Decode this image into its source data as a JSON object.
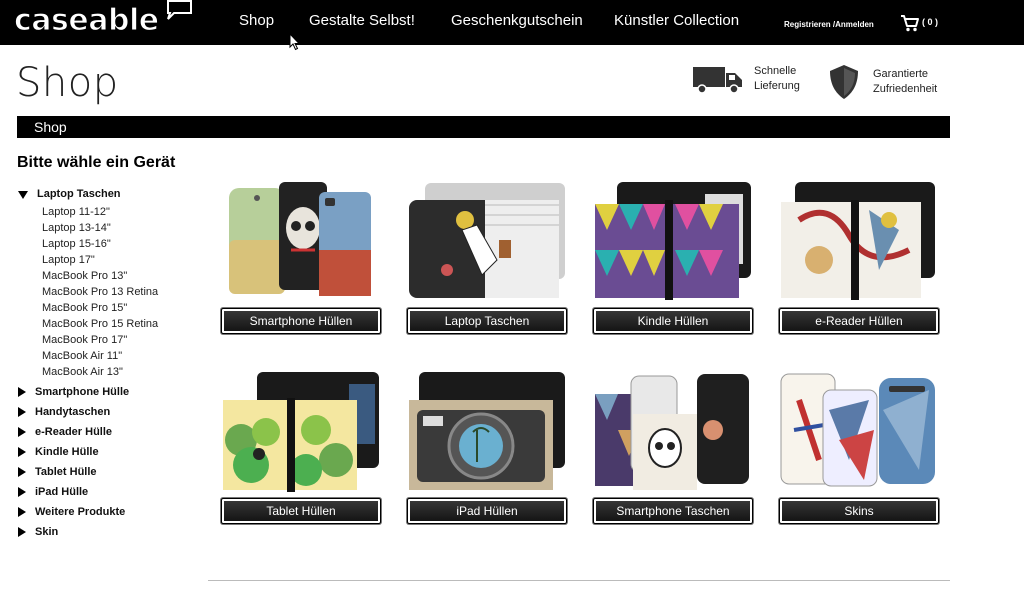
{
  "brand": {
    "logo_text": "caseable"
  },
  "nav": [
    {
      "label": "Shop"
    },
    {
      "label": "Gestalte Selbst!"
    },
    {
      "label": "Geschenkgutschein"
    },
    {
      "label": "Künstler Collection"
    }
  ],
  "account": {
    "label": "Registrieren /Anmelden",
    "cart_count": "( 0 )"
  },
  "header": {
    "title": "Shop",
    "badges": [
      {
        "icon": "truck-icon",
        "line1": "Schnelle",
        "line2": "Lieferung"
      },
      {
        "icon": "shield-icon",
        "line1": "Garantierte",
        "line2": "Zufriedenheit"
      }
    ]
  },
  "breadcrumb": {
    "label": "Shop"
  },
  "sidebar": {
    "title": "Bitte wähle ein Gerät",
    "expanded": {
      "label": "Laptop Taschen"
    },
    "subitems": [
      "Laptop 11-12\"",
      "Laptop 13-14\"",
      "Laptop 15-16\"",
      "Laptop 17\"",
      "MacBook Pro 13\"",
      "MacBook Pro 13 Retina",
      "MacBook Pro 15\"",
      "MacBook Pro 15 Retina",
      "MacBook Pro 17\"",
      "MacBook Air 11\"",
      "MacBook Air 13\""
    ],
    "categories": [
      "Smartphone Hülle",
      "Handytaschen",
      "e-Reader Hülle",
      "Kindle Hülle",
      "Tablet Hülle",
      "iPad Hülle",
      "Weitere Produkte",
      "Skin"
    ]
  },
  "products": [
    {
      "label": "Smartphone Hüllen"
    },
    {
      "label": "Laptop Taschen"
    },
    {
      "label": "Kindle Hüllen"
    },
    {
      "label": "e-Reader Hüllen"
    },
    {
      "label": "Tablet Hüllen"
    },
    {
      "label": "iPad Hüllen"
    },
    {
      "label": "Smartphone Taschen"
    },
    {
      "label": "Skins"
    }
  ],
  "colors": {
    "bar": "#000000",
    "button_top": "#3a3a3a",
    "button_bottom": "#111111"
  }
}
